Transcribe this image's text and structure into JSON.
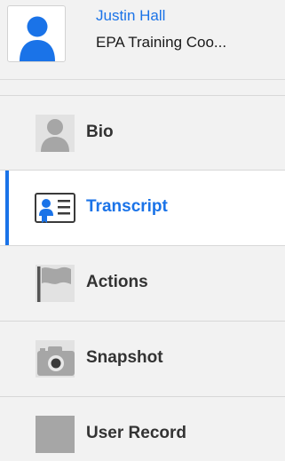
{
  "profile": {
    "name": "Justin Hall",
    "role": "EPA Training Coo..."
  },
  "nav": {
    "items": [
      {
        "label": "Bio",
        "icon": "person-icon"
      },
      {
        "label": "Transcript",
        "icon": "transcript-icon",
        "active": true
      },
      {
        "label": "Actions",
        "icon": "flag-icon"
      },
      {
        "label": "Snapshot",
        "icon": "camera-icon"
      },
      {
        "label": "User Record",
        "icon": "record-icon"
      }
    ]
  },
  "colors": {
    "accent": "#1a73e8",
    "background": "#f2f2f2",
    "active_background": "#ffffff",
    "icon_gray": "#a6a6a6"
  }
}
